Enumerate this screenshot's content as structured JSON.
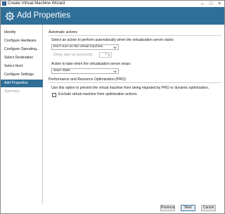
{
  "window": {
    "title": "Create Virtual Machine Wizard"
  },
  "header": {
    "title": "Add Properties",
    "icon": "gear-icon",
    "background": "#2f6e97"
  },
  "sidebar": {
    "items": [
      {
        "label": "Identity",
        "state": "normal"
      },
      {
        "label": "Configure Hardware",
        "state": "normal"
      },
      {
        "label": "Configure Operating...",
        "state": "normal"
      },
      {
        "label": "Select Destination",
        "state": "normal"
      },
      {
        "label": "Select Host",
        "state": "normal"
      },
      {
        "label": "Configure Settings",
        "state": "normal"
      },
      {
        "label": "Add Properties",
        "state": "active"
      },
      {
        "label": "Summary",
        "state": "disabled"
      }
    ]
  },
  "automatic_actions": {
    "heading": "Automatic actions",
    "start_prompt": "Select an action to perform automatically when the virtualization server starts:",
    "start_action": "Don't turn on the virtual machine",
    "delay_label": "Delay start up (seconds):",
    "delay_value": "0",
    "stop_prompt": "Action to take when the virtualization server stops:",
    "stop_action": "Save State"
  },
  "pro": {
    "heading": "Performance and Resource Optimization (PRO)",
    "description": "Use this option to prevent the virtual machine from being migrated by PRO or dynamic optimization.",
    "exclude_label": "Exclude virtual machine from optimization actions",
    "exclude_checked": false
  },
  "footer": {
    "previous_label": "Previous",
    "next_label": "Next",
    "cancel_label": "Cancel"
  }
}
